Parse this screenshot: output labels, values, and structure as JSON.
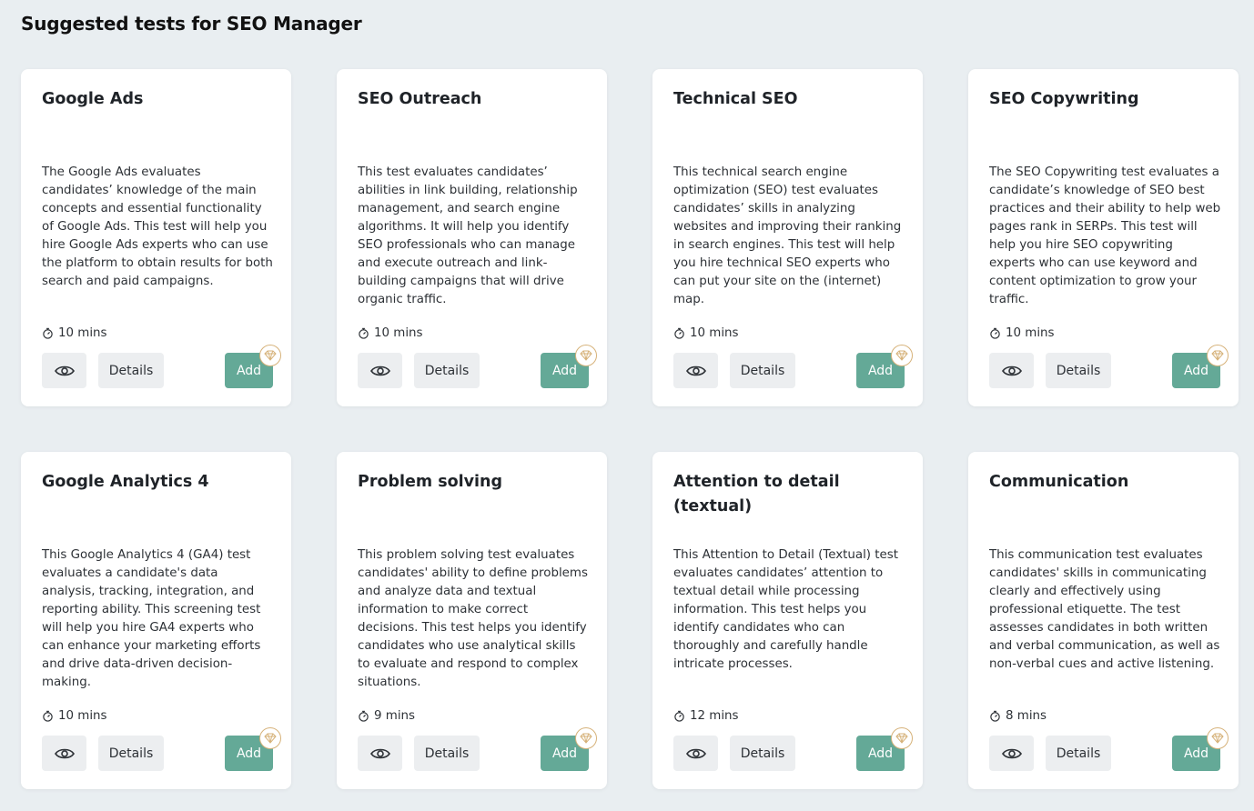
{
  "page": {
    "title": "Suggested tests for SEO Manager"
  },
  "colors": {
    "background": "#e9eef1",
    "card": "#ffffff",
    "add_button": "#64a997",
    "neutral_button": "#eceef0",
    "premium_badge": "#d6b27a"
  },
  "icons": {
    "duration": "stopwatch-icon",
    "preview": "eye-icon",
    "premium": "diamond-icon"
  },
  "labels": {
    "details": "Details",
    "add": "Add"
  },
  "tests": [
    {
      "title": "Google Ads",
      "description": "The Google Ads evaluates candidates’ knowledge of the main concepts and essential functionality of Google Ads. This test will help you hire Google Ads experts who can use the platform to obtain results for both search and paid campaigns.",
      "duration": "10 mins"
    },
    {
      "title": "SEO Outreach",
      "description": "This test evaluates candidates’ abilities in link building, relationship management, and search engine algorithms. It will help you identify SEO professionals who can manage and execute outreach and link-building campaigns that will drive organic traffic.",
      "duration": "10 mins"
    },
    {
      "title": "Technical SEO",
      "description": "This technical search engine optimization (SEO) test evaluates candidates’ skills in analyzing websites and improving their ranking in search engines. This test will help you hire technical SEO experts who can put your site on the (internet) map.",
      "duration": "10 mins"
    },
    {
      "title": "SEO Copywriting",
      "description": "The SEO Copywriting test evaluates a candidate’s knowledge of SEO best practices and their ability to help web pages rank in SERPs. This test will help you hire SEO copywriting experts who can use keyword and content optimization to grow your traffic.",
      "duration": "10 mins"
    },
    {
      "title": "Google Analytics 4",
      "description": "This Google Analytics 4 (GA4) test evaluates a candidate's data analysis, tracking, integration, and reporting ability. This screening test will help you hire GA4 experts who can enhance your marketing efforts and drive data-driven decision-making.",
      "duration": "10 mins"
    },
    {
      "title": "Problem solving",
      "description": "This problem solving test evaluates candidates' ability to define problems and analyze data and textual information to make correct decisions. This test helps you identify candidates who use analytical skills to evaluate and respond to complex situations.",
      "duration": "9 mins"
    },
    {
      "title": "Attention to detail (textual)",
      "description": "This Attention to Detail (Textual) test evaluates candidates’ attention to textual detail while processing information. This test helps you identify candidates who can thoroughly and carefully handle intricate processes.",
      "duration": "12 mins"
    },
    {
      "title": "Communication",
      "description": "This communication test evaluates candidates' skills in communicating clearly and effectively using professional etiquette. The test assesses candidates in both written and verbal communication, as well as non-verbal cues and active listening.",
      "duration": "8 mins"
    }
  ]
}
